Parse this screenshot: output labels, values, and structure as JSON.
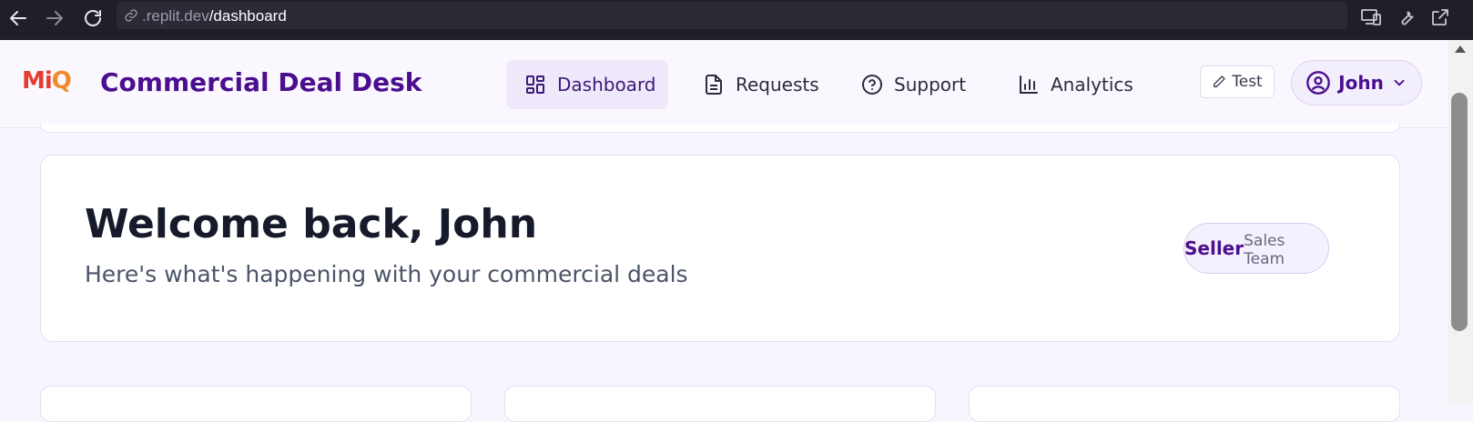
{
  "browser": {
    "url_prefix": ".replit.dev",
    "url_path": "/dashboard"
  },
  "header": {
    "logo": {
      "m": "M",
      "i": "i",
      "q": "Q"
    },
    "title": "Commercial Deal Desk",
    "nav": [
      {
        "label": "Dashboard",
        "icon": "dashboard-grid-icon",
        "active": true
      },
      {
        "label": "Requests",
        "icon": "document-icon",
        "active": false
      },
      {
        "label": "Support",
        "icon": "help-circle-icon",
        "active": false
      },
      {
        "label": "Analytics",
        "icon": "bar-chart-icon",
        "active": false
      }
    ],
    "test_label": "Test",
    "user_label": "John"
  },
  "welcome": {
    "title": "Welcome back, John",
    "subtitle": "Here's what's happening with your commercial deals",
    "role": "Seller",
    "team": "Sales Team"
  },
  "colors": {
    "brand_purple": "#4a0e8f",
    "active_nav_bg": "#efe8fb",
    "page_bg": "#f7f5fd"
  }
}
